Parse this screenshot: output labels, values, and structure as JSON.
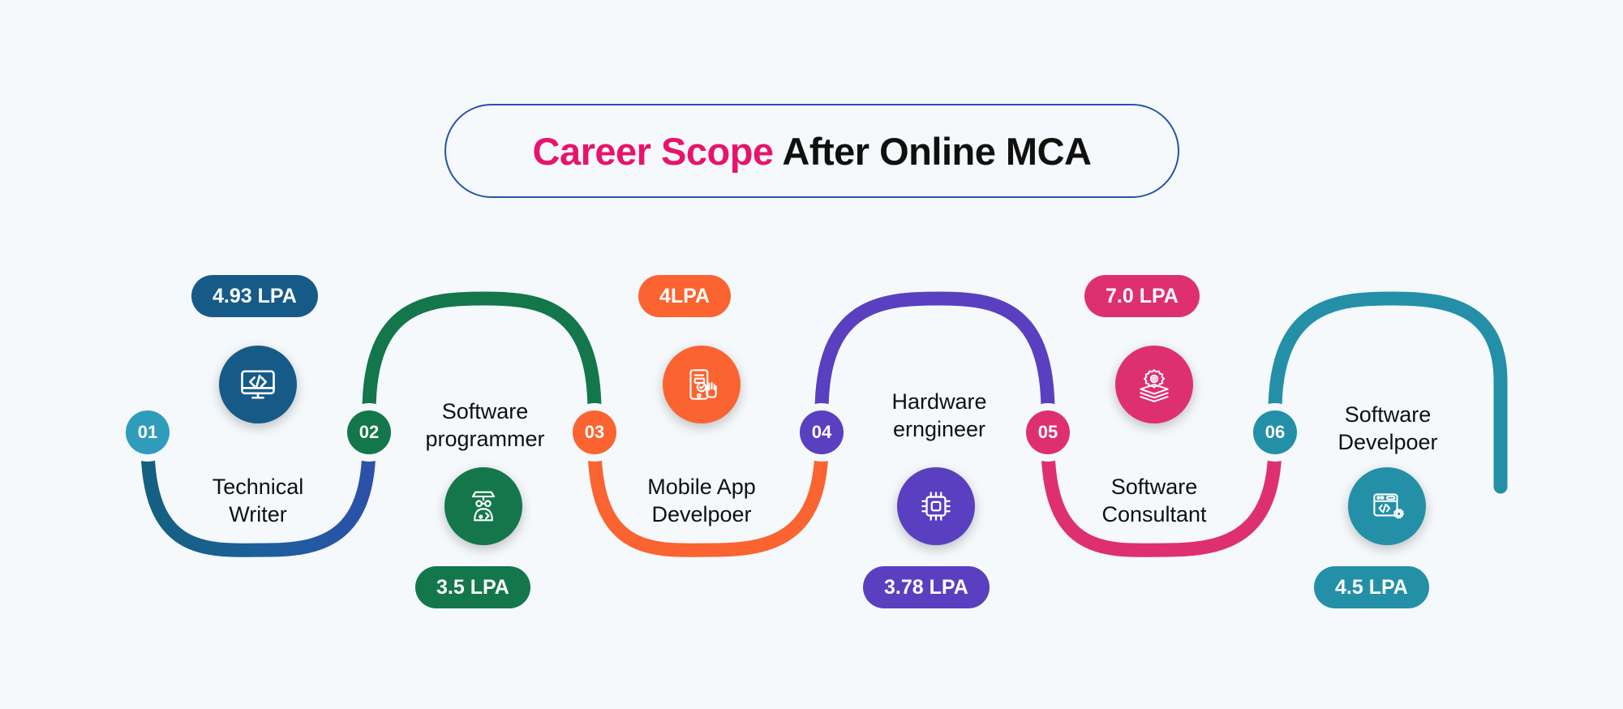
{
  "page": {
    "background_color": "#f5f9fc",
    "title_accent": "Career Scope",
    "title_rest": " After Online MCA",
    "title_accent_color": "#e8136c",
    "title_rest_color": "#10110f",
    "title_border_color": "#2b51a8"
  },
  "steps": [
    {
      "number": "01",
      "role": "Technical\nWriter",
      "salary": "4.93  LPA",
      "salary_position": "above",
      "color": "#165b88",
      "marker_color": "#2f9cbb",
      "icon": "monitor-code-icon"
    },
    {
      "number": "02",
      "role": "Software\nprogrammer",
      "salary": "3.5 LPA",
      "salary_position": "below",
      "color": "#13774b",
      "marker_color": "#13774b",
      "icon": "programmer-avatar-icon"
    },
    {
      "number": "03",
      "role": "Mobile App\nDevelpoer",
      "salary": "4LPA",
      "salary_position": "above",
      "color": "#fb6330",
      "marker_color": "#fb6330",
      "icon": "mobile-tap-icon"
    },
    {
      "number": "04",
      "role": "Hardware\nerngineer",
      "salary": "3.78 LPA",
      "salary_position": "below",
      "color": "#5a3fc0",
      "marker_color": "#5a3fc0",
      "icon": "cpu-chip-icon"
    },
    {
      "number": "05",
      "role": "Software\nConsultant",
      "salary": "7.0 LPA",
      "salary_position": "above",
      "color": "#de3070",
      "marker_color": "#de3070",
      "icon": "layers-gear-icon"
    },
    {
      "number": "06",
      "role": "Software\nDevelpoer",
      "salary": "4.5 LPA",
      "salary_position": "below",
      "color": "#2490a8",
      "marker_color": "#2490a8",
      "icon": "browser-code-gear-icon"
    }
  ],
  "wave": {
    "segments": [
      {
        "name": "start-stub",
        "from": "#2b51a8",
        "to": "#1d63a0"
      },
      {
        "name": "trough-01-02",
        "from": "#15607f",
        "to": "#2b51a8"
      },
      {
        "name": "crest-02-03",
        "from": "#13774b",
        "to": "#13774b"
      },
      {
        "name": "trough-03-04",
        "from": "#fb6330",
        "to": "#fb6330"
      },
      {
        "name": "crest-04-05",
        "from": "#5a3fc0",
        "to": "#5a3fc0"
      },
      {
        "name": "trough-05-06",
        "from": "#de3070",
        "to": "#de3070"
      },
      {
        "name": "crest-06-end",
        "from": "#2490a8",
        "to": "#2490a8"
      }
    ]
  }
}
